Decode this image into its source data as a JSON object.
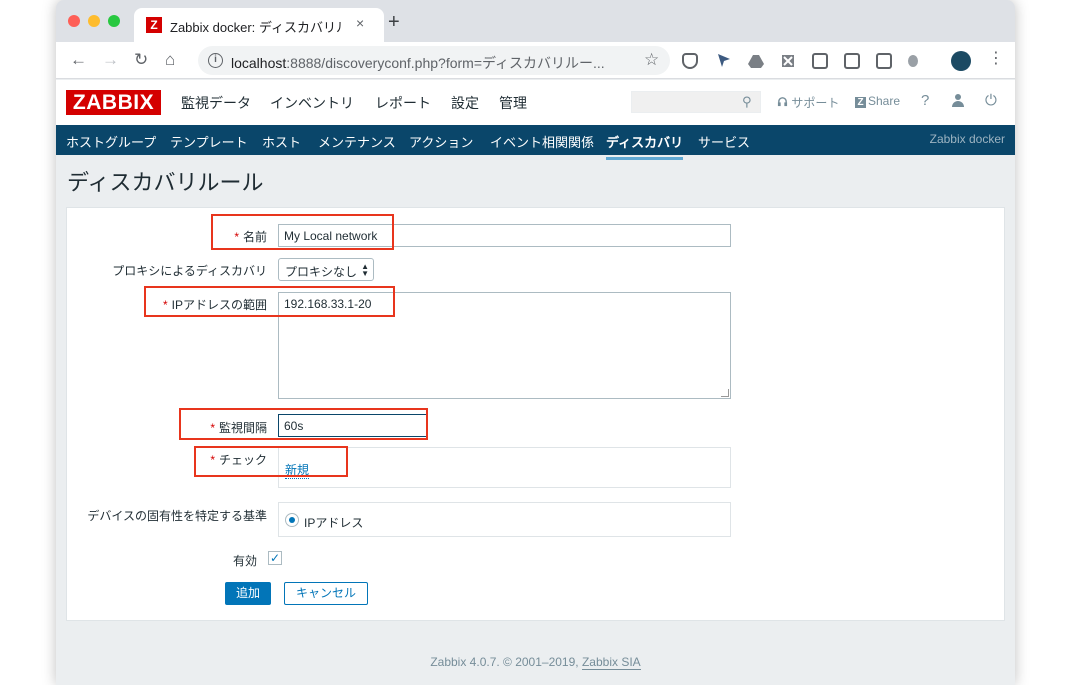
{
  "browser": {
    "tab_title": "Zabbix docker: ディスカバリルール",
    "tab_favicon": "Z",
    "tab_close": "×",
    "new_tab": "+",
    "url_host": "localhost",
    "url_rest": ":8888/discoveryconf.php?form=ディスカバリルー...",
    "back_icon": "←",
    "forward_icon": "→",
    "reload_icon": "↻",
    "home_icon": "⌂",
    "star_icon": "☆",
    "menu_icon": "⋮"
  },
  "header": {
    "logo": "ZABBIX",
    "menu": [
      "監視データ",
      "インベントリ",
      "レポート",
      "設定",
      "管理"
    ],
    "active_menu_index": 3,
    "support": "サポート",
    "share": "Share",
    "share_icon": "Z",
    "help_icon": "?",
    "power_icon": "⏻",
    "search_icon": "⚲"
  },
  "submenu": {
    "items": [
      "ホストグループ",
      "テンプレート",
      "ホスト",
      "メンテナンス",
      "アクション",
      "イベント相関関係",
      "ディスカバリ",
      "サービス"
    ],
    "active_index": 6,
    "server_name": "Zabbix docker"
  },
  "page": {
    "title": "ディスカバリルール"
  },
  "form": {
    "required_mark": "*",
    "name_label": "名前",
    "name_value": "My Local network",
    "proxy_label": "プロキシによるディスカバリ",
    "proxy_value": "プロキシなし",
    "ip_range_label": "IPアドレスの範囲",
    "ip_range_value": "192.168.33.1-20",
    "interval_label": "監視間隔",
    "interval_value": "60s",
    "checks_label": "チェック",
    "checks_new_link": "新規",
    "uniqueness_label": "デバイスの固有性を特定する基準",
    "uniqueness_option": "IPアドレス",
    "enabled_label": "有効",
    "enabled_checked": true,
    "enabled_mark": "✓",
    "add_button": "追加",
    "cancel_button": "キャンセル"
  },
  "footer": {
    "text": "Zabbix 4.0.7. © 2001–2019,",
    "link": "Zabbix SIA"
  },
  "colors": {
    "brand_red": "#d40000",
    "nav_blue": "#0a466a",
    "link_blue": "#0275b8",
    "highlight_red": "#e8351d"
  }
}
